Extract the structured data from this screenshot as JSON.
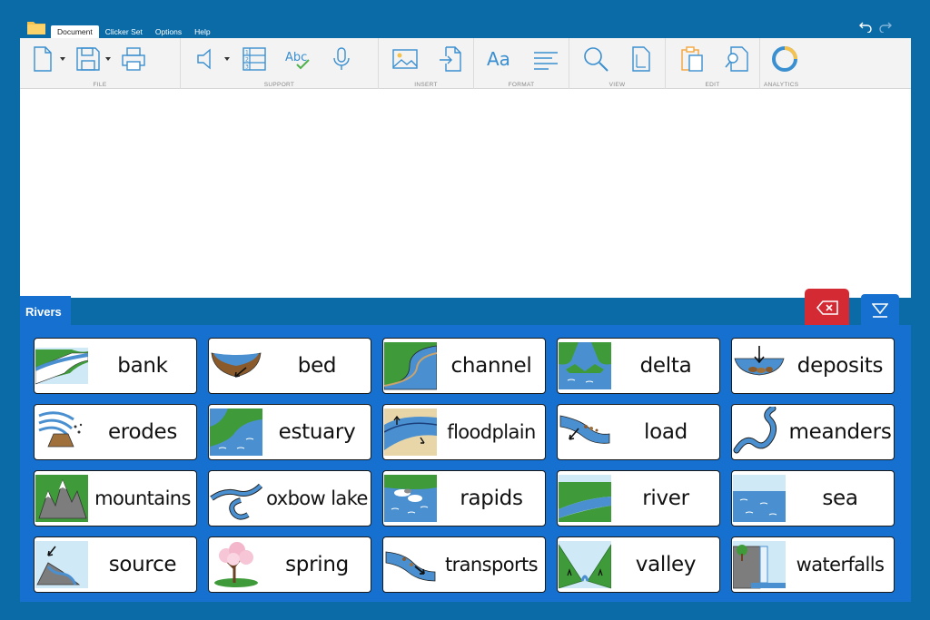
{
  "menu": {
    "tabs": [
      "Document",
      "Clicker Set",
      "Options",
      "Help"
    ],
    "active": "Document"
  },
  "ribbon": {
    "groups": [
      {
        "label": "FILE"
      },
      {
        "label": "SUPPORT"
      },
      {
        "label": "INSERT"
      },
      {
        "label": "FORMAT"
      },
      {
        "label": "VIEW"
      },
      {
        "label": "EDIT"
      },
      {
        "label": "ANALYTICS"
      }
    ]
  },
  "clicker": {
    "set_name": "Rivers",
    "cells": [
      {
        "word": "bank",
        "picture": "river-bank-picture"
      },
      {
        "word": "bed",
        "picture": "river-bed-picture"
      },
      {
        "word": "channel",
        "picture": "channel-picture"
      },
      {
        "word": "delta",
        "picture": "delta-picture"
      },
      {
        "word": "deposits",
        "picture": "deposits-picture"
      },
      {
        "word": "erodes",
        "picture": "erodes-picture"
      },
      {
        "word": "estuary",
        "picture": "estuary-picture"
      },
      {
        "word": "floodplain",
        "picture": "floodplain-picture"
      },
      {
        "word": "load",
        "picture": "load-picture"
      },
      {
        "word": "meanders",
        "picture": "meanders-picture"
      },
      {
        "word": "mountains",
        "picture": "mountains-picture"
      },
      {
        "word": "oxbow lake",
        "picture": "oxbow-lake-picture"
      },
      {
        "word": "rapids",
        "picture": "rapids-picture"
      },
      {
        "word": "river",
        "picture": "river-picture"
      },
      {
        "word": "sea",
        "picture": "sea-picture"
      },
      {
        "word": "source",
        "picture": "source-picture"
      },
      {
        "word": "spring",
        "picture": "spring-picture"
      },
      {
        "word": "transports",
        "picture": "transports-picture"
      },
      {
        "word": "valley",
        "picture": "valley-picture"
      },
      {
        "word": "waterfalls",
        "picture": "waterfalls-picture"
      }
    ]
  },
  "colors": {
    "background": "#0a6ba6",
    "panel": "#1570d0",
    "delete": "#d42a34",
    "icon": "#3a8fd0"
  }
}
